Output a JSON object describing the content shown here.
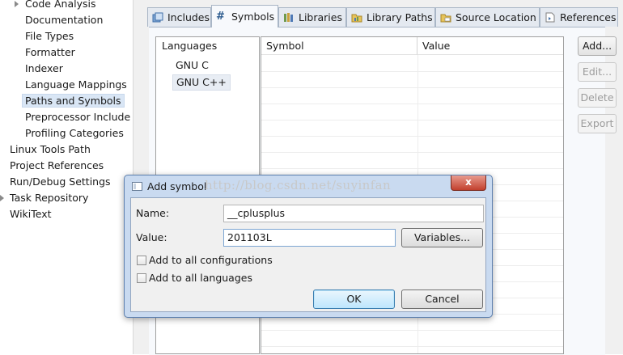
{
  "tree": {
    "items": [
      {
        "label": "Code Analysis"
      },
      {
        "label": "Documentation"
      },
      {
        "label": "File Types"
      },
      {
        "label": "Formatter"
      },
      {
        "label": "Indexer"
      },
      {
        "label": "Language Mappings"
      },
      {
        "label": "Paths and Symbols"
      },
      {
        "label": "Preprocessor Include"
      },
      {
        "label": "Profiling Categories"
      },
      {
        "label": "Linux Tools Path"
      },
      {
        "label": "Project References"
      },
      {
        "label": "Run/Debug Settings"
      },
      {
        "label": "Task Repository"
      },
      {
        "label": "WikiText"
      }
    ],
    "selected_label": "Paths and Symbols"
  },
  "tabs": [
    {
      "label": "Includes",
      "icon": "includes-icon"
    },
    {
      "label": "Symbols",
      "icon": "hash-icon"
    },
    {
      "label": "Libraries",
      "icon": "libraries-icon"
    },
    {
      "label": "Library Paths",
      "icon": "library-paths-icon"
    },
    {
      "label": "Source Location",
      "icon": "source-location-icon"
    },
    {
      "label": "References",
      "icon": "references-icon"
    }
  ],
  "active_tab": "Symbols",
  "languages": {
    "header": "Languages",
    "items": [
      "GNU C",
      "GNU C++"
    ],
    "selected": "GNU C++"
  },
  "symbols_table": {
    "columns": [
      "Symbol",
      "Value"
    ],
    "rows": []
  },
  "side_buttons": {
    "add": "Add...",
    "edit": "Edit...",
    "delete": "Delete",
    "export": "Export"
  },
  "dialog": {
    "title": "Add symbol",
    "name_label": "Name:",
    "name_value": "__cplusplus",
    "value_label": "Value:",
    "value_value": "201103L",
    "variables_button": "Variables...",
    "check_all_configs": "Add to all configurations",
    "check_all_configs_checked": false,
    "check_all_languages": "Add to all languages",
    "check_all_languages_checked": false,
    "ok": "OK",
    "cancel": "Cancel",
    "close_glyph": "x"
  },
  "watermark": "http://blog.csdn.net/suyinfan"
}
